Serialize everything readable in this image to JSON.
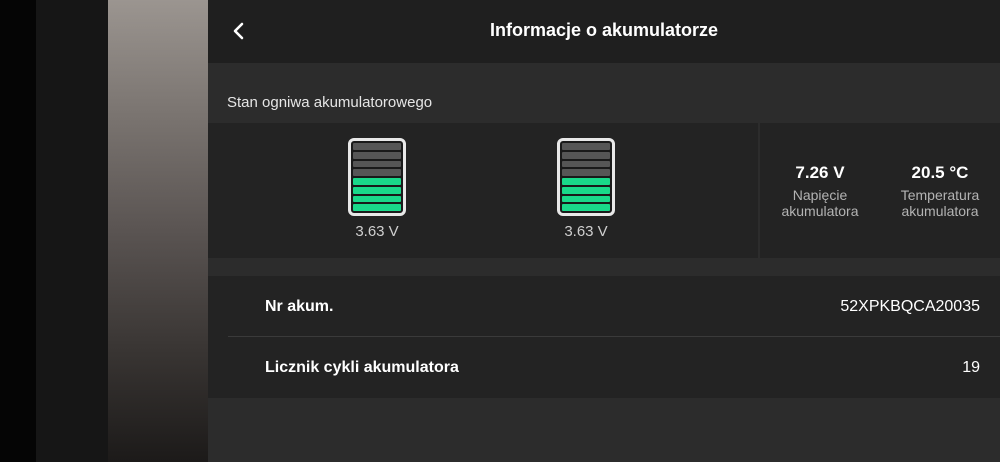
{
  "header": {
    "title": "Informacje o akumulatorze"
  },
  "section": {
    "label": "Stan ogniwa akumulatorowego"
  },
  "cells": [
    {
      "voltage": "3.63 V",
      "charge_fraction": 0.55
    },
    {
      "voltage": "3.63 V",
      "charge_fraction": 0.55
    }
  ],
  "stats": {
    "voltage": {
      "value": "7.26 V",
      "label": "Napięcie akumulatora"
    },
    "temperature": {
      "value": "20.5 °C",
      "label": "Temperatura akumulatora"
    }
  },
  "info": {
    "serial": {
      "label": "Nr akum.",
      "value": "52XPKBQCA20035"
    },
    "cycles": {
      "label": "Licznik cykli akumulatora",
      "value": "19"
    }
  },
  "colors": {
    "charged": "#19d98a",
    "empty": "#565656"
  },
  "icons": {
    "back": "chevron-left-icon"
  }
}
